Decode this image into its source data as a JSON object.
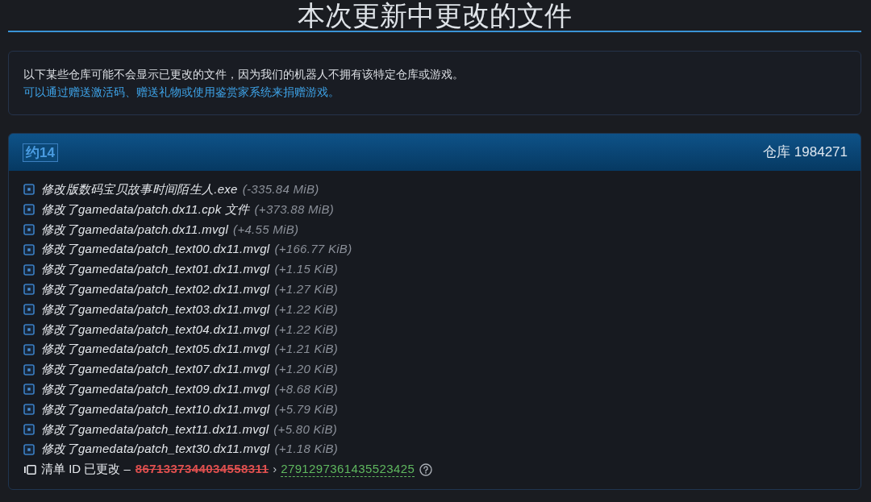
{
  "title": "本次更新中更改的文件",
  "notice": {
    "text": "以下某些仓库可能不会显示已更改的文件，因为我们的机器人不拥有该特定仓库或游戏。",
    "link": "可以通过赠送激活码、赠送礼物或使用鉴赏家系统来捐赠游戏。"
  },
  "depot": {
    "badge": "约14",
    "label": "仓库 1984271",
    "files": [
      {
        "text": "修改版数码宝贝故事时间陌生人.exe",
        "size": "(-335.84 MiB)"
      },
      {
        "text": "修改了gamedata/patch.dx11.cpk 文件",
        "size": "(+373.88 MiB)"
      },
      {
        "text": "修改了gamedata/patch.dx11.mvgl",
        "size": "(+4.55 MiB)"
      },
      {
        "text": "修改了gamedata/patch_text00.dx11.mvgl",
        "size": "(+166.77 KiB)"
      },
      {
        "text": "修改了gamedata/patch_text01.dx11.mvgl",
        "size": "(+1.15 KiB)"
      },
      {
        "text": "修改了gamedata/patch_text02.dx11.mvgl",
        "size": "(+1.27 KiB)"
      },
      {
        "text": "修改了gamedata/patch_text03.dx11.mvgl",
        "size": "(+1.22 KiB)"
      },
      {
        "text": "修改了gamedata/patch_text04.dx11.mvgl",
        "size": "(+1.22 KiB)"
      },
      {
        "text": "修改了gamedata/patch_text05.dx11.mvgl",
        "size": "(+1.21 KiB)"
      },
      {
        "text": "修改了gamedata/patch_text07.dx11.mvgl",
        "size": "(+1.20 KiB)"
      },
      {
        "text": "修改了gamedata/patch_text09.dx11.mvgl",
        "size": "(+8.68 KiB)"
      },
      {
        "text": "修改了gamedata/patch_text10.dx11.mvgl",
        "size": "(+5.79 KiB)"
      },
      {
        "text": "修改了gamedata/patch_text11.dx11.mvgl",
        "size": "(+5.80 KiB)"
      },
      {
        "text": "修改了gamedata/patch_text30.dx11.mvgl",
        "size": "(+1.18 KiB)"
      }
    ],
    "manifest": {
      "label": "清单 ID 已更改 –",
      "old_id": "8671337344034558311",
      "separator": "›",
      "new_id": "2791297361435523425"
    }
  }
}
